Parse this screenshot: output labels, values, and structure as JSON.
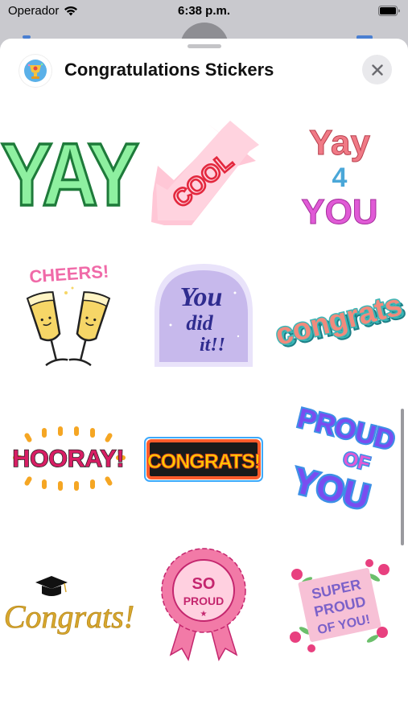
{
  "status_bar": {
    "carrier": "Operador",
    "time": "6:38 p.m."
  },
  "sheet": {
    "title": "Congratulations Stickers"
  },
  "stickers": [
    {
      "name": "sticker-yay",
      "text": "YAY",
      "colors": {
        "fill": "#8ef0a0",
        "stroke": "#1e7a3a"
      }
    },
    {
      "name": "sticker-cool",
      "text": "COOL",
      "colors": {
        "fill": "#ffc7d6",
        "text": "#e3283e"
      }
    },
    {
      "name": "sticker-yay-4-you",
      "lines": [
        "Yay",
        "4",
        "YOU"
      ],
      "colors": {
        "yay": "#f07a86",
        "four": "#4aa7d8",
        "you": "#e05ad6"
      }
    },
    {
      "name": "sticker-cheers",
      "text": "CHEERS!",
      "colors": {
        "text": "#f06aa8",
        "glass": "#f6d667"
      }
    },
    {
      "name": "sticker-you-did-it",
      "lines": [
        "You",
        "did",
        "it!!"
      ],
      "colors": {
        "bg": "#c7b9ec",
        "text": "#2f2c8f"
      }
    },
    {
      "name": "sticker-congrats-3d",
      "text": "congrats",
      "colors": {
        "front": "#f28a7c",
        "shadow": "#3bb7b7"
      }
    },
    {
      "name": "sticker-hooray",
      "text": "HOORAY!",
      "colors": {
        "text": "#d81e64",
        "dots": "#f5a623"
      }
    },
    {
      "name": "sticker-congrats-banner",
      "text": "CONGRATS!",
      "colors": {
        "text": "#ffcc00",
        "bg": "#1a1a1a",
        "border": "#ff5b2b"
      }
    },
    {
      "name": "sticker-proud-of-you",
      "lines": [
        "PROUD",
        "OF",
        "YOU"
      ],
      "colors": {
        "front": "#7a4df0",
        "shadow": "#3d8fe6"
      }
    },
    {
      "name": "sticker-congrats-script",
      "text": "Congrats!",
      "colors": {
        "text": "#d8a82e",
        "cap": "#111111"
      }
    },
    {
      "name": "sticker-so-proud",
      "lines": [
        "SO",
        "PROUD"
      ],
      "colors": {
        "rosette": "#f27aa7",
        "inner": "#ffd0e0",
        "text": "#c4266e"
      }
    },
    {
      "name": "sticker-super-proud",
      "lines": [
        "SUPER",
        "PROUD",
        "OF YOU!"
      ],
      "colors": {
        "banner": "#f7c1d6",
        "text": "#7b61c9",
        "flowers": "#e8407f"
      }
    }
  ]
}
